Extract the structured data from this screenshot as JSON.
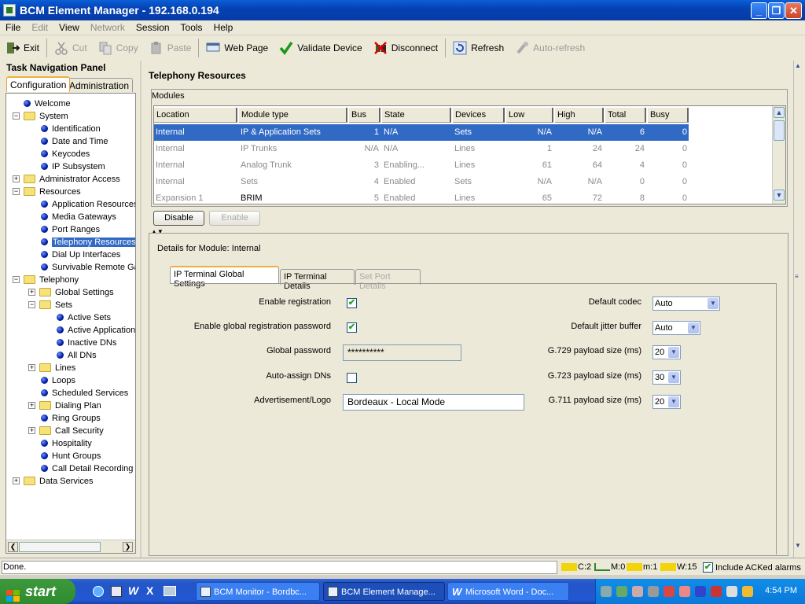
{
  "window": {
    "title": "BCM Element Manager - 192.168.0.194"
  },
  "menu": [
    "File",
    "Edit",
    "View",
    "Network",
    "Session",
    "Tools",
    "Help"
  ],
  "menu_disabled": [
    "Edit",
    "Network"
  ],
  "toolbar": {
    "exit": "Exit",
    "cut": "Cut",
    "copy": "Copy",
    "paste": "Paste",
    "web_page": "Web Page",
    "validate": "Validate Device",
    "disconnect": "Disconnect",
    "refresh": "Refresh",
    "auto_refresh": "Auto-refresh"
  },
  "nav": {
    "title": "Task Navigation Panel",
    "tabs": [
      "Configuration",
      "Administration"
    ],
    "tree": [
      {
        "label": "Welcome"
      },
      {
        "label": "System"
      },
      {
        "label": "Identification"
      },
      {
        "label": "Date and Time"
      },
      {
        "label": "Keycodes"
      },
      {
        "label": "IP Subsystem"
      },
      {
        "label": "Administrator Access"
      },
      {
        "label": "Resources"
      },
      {
        "label": "Application Resources"
      },
      {
        "label": "Media Gateways"
      },
      {
        "label": "Port Ranges"
      },
      {
        "label": "Telephony Resources"
      },
      {
        "label": "Dial Up Interfaces"
      },
      {
        "label": "Survivable Remote Gateway"
      },
      {
        "label": "Telephony"
      },
      {
        "label": "Global Settings"
      },
      {
        "label": "Sets"
      },
      {
        "label": "Active Sets"
      },
      {
        "label": "Active Application Sets"
      },
      {
        "label": "Inactive DNs"
      },
      {
        "label": "All DNs"
      },
      {
        "label": "Lines"
      },
      {
        "label": "Loops"
      },
      {
        "label": "Scheduled Services"
      },
      {
        "label": "Dialing Plan"
      },
      {
        "label": "Ring Groups"
      },
      {
        "label": "Call Security"
      },
      {
        "label": "Hospitality"
      },
      {
        "label": "Hunt Groups"
      },
      {
        "label": "Call Detail Recording"
      },
      {
        "label": "Data Services"
      }
    ]
  },
  "main": {
    "title": "Telephony Resources",
    "modules_label": "Modules",
    "columns": [
      "Location",
      "Module type",
      "Bus",
      "State",
      "Devices",
      "Low",
      "High",
      "Total",
      "Busy"
    ],
    "rows": [
      [
        "Internal",
        "IP & Application Sets",
        "1",
        "N/A",
        "Sets",
        "N/A",
        "N/A",
        "6",
        "0"
      ],
      [
        "Internal",
        "IP Trunks",
        "N/A",
        "N/A",
        "Lines",
        "1",
        "24",
        "24",
        "0"
      ],
      [
        "Internal",
        "Analog Trunk",
        "3",
        "Enabling...",
        "Lines",
        "61",
        "64",
        "4",
        "0"
      ],
      [
        "Internal",
        "Sets",
        "4",
        "Enabled",
        "Sets",
        "N/A",
        "N/A",
        "0",
        "0"
      ],
      [
        "Expansion 1",
        "BRIM",
        "5",
        "Enabled",
        "Lines",
        "65",
        "72",
        "8",
        "0"
      ]
    ],
    "disable_btn": "Disable",
    "enable_btn": "Enable",
    "details_title": "Details for Module: Internal",
    "detail_tabs": [
      "IP Terminal Global Settings",
      "IP Terminal Details",
      "Set Port Details"
    ],
    "form": {
      "enable_registration": "Enable registration",
      "enable_global_pw": "Enable global registration password",
      "global_password": "Global password",
      "global_password_value": "**********",
      "auto_assign": "Auto-assign DNs",
      "advert_logo": "Advertisement/Logo",
      "advert_logo_value": "Bordeaux - Local Mode",
      "default_codec": "Default codec",
      "default_codec_value": "Auto",
      "jitter": "Default jitter buffer",
      "jitter_value": "Auto",
      "g729": "G.729 payload size (ms)",
      "g729_value": "20",
      "g723": "G.723 payload size (ms)",
      "g723_value": "30",
      "g711": "G.711 payload size (ms)",
      "g711_value": "20"
    }
  },
  "status": {
    "text": "Done.",
    "alarms": [
      {
        "label": "C:2",
        "color": "#f2d40a"
      },
      {
        "label": "M:0",
        "color": "#2a8a2a"
      },
      {
        "label": "m:1",
        "color": "#f2d40a"
      },
      {
        "label": "W:15",
        "color": "#f2d40a"
      }
    ],
    "include_acked": "Include ACKed alarms"
  },
  "taskbar": {
    "start": "start",
    "tasks": [
      "BCM Monitor - Bordbc...",
      "BCM Element Manage...",
      "Microsoft Word - Doc..."
    ],
    "clock": "4:54 PM"
  }
}
